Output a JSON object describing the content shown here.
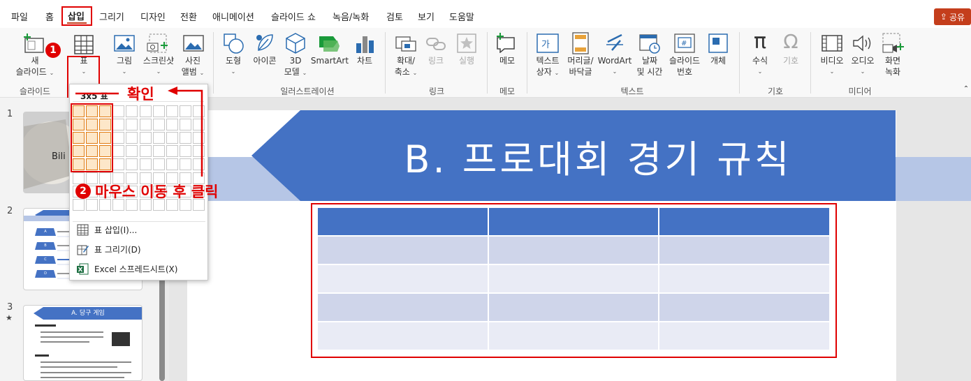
{
  "tabs": [
    "파일",
    "홈",
    "삽입",
    "그리기",
    "디자인",
    "전환",
    "애니메이션",
    "슬라이드 쇼",
    "녹음/녹화",
    "검토",
    "보기",
    "도움말"
  ],
  "active_tab": "삽입",
  "share_label": "공유",
  "ribbon": {
    "new_slide": [
      "새",
      "슬라이드"
    ],
    "table": "표",
    "picture": "그림",
    "screenshot": "스크린샷",
    "photo_album": [
      "사진",
      "앨범"
    ],
    "shapes": "도형",
    "icons": "아이콘",
    "model3d": [
      "3D",
      "모델"
    ],
    "smartart": "SmartArt",
    "chart": "차트",
    "zoom": [
      "확대/",
      "축소"
    ],
    "link": "링크",
    "action": "실행",
    "comment": "메모",
    "textbox": [
      "텍스트",
      "상자"
    ],
    "header_footer": [
      "머리글/",
      "바닥글"
    ],
    "wordart": "WordArt",
    "date_time": [
      "날짜",
      "및 시간"
    ],
    "slide_number": [
      "슬라이드",
      "번호"
    ],
    "object": "개체",
    "equation": "수식",
    "symbol": "기호",
    "video": "비디오",
    "audio": "오디오",
    "screen_recording": [
      "화면",
      "녹화"
    ],
    "groups": {
      "slides": "슬라이드",
      "illustrations": "일러스트레이션",
      "links": "링크",
      "comments": "메모",
      "text": "텍스트",
      "symbols": "기호",
      "media": "미디어"
    }
  },
  "dropdown": {
    "size_label": "3x5 표",
    "insert_table": "표 삽입(I)...",
    "draw_table": "표 그리기(D)",
    "excel_sheet": "Excel 스프레드시트(X)",
    "selected_cols": 3,
    "selected_rows": 5
  },
  "annotations": {
    "badge1": "1",
    "badge2": "2",
    "confirm": "확인",
    "instruction": "마우스 이동 후 클릭"
  },
  "thumbnails": {
    "numbers": [
      "1",
      "2",
      "3"
    ],
    "slide1_text": "Bili",
    "slide2_rows": [
      "A",
      "B",
      "C",
      "D"
    ],
    "slide3_title": "A. 당구 게임",
    "slide3_star": "★"
  },
  "slide": {
    "title": "B. 프로대회 경기 규칙",
    "table_rows": 5,
    "table_cols": 3
  },
  "colors": {
    "accent": "#4472c4",
    "band1": "#cfd5ea",
    "band2": "#e9ebf5",
    "annotation_red": "#e00000",
    "share": "#c43e1c"
  }
}
